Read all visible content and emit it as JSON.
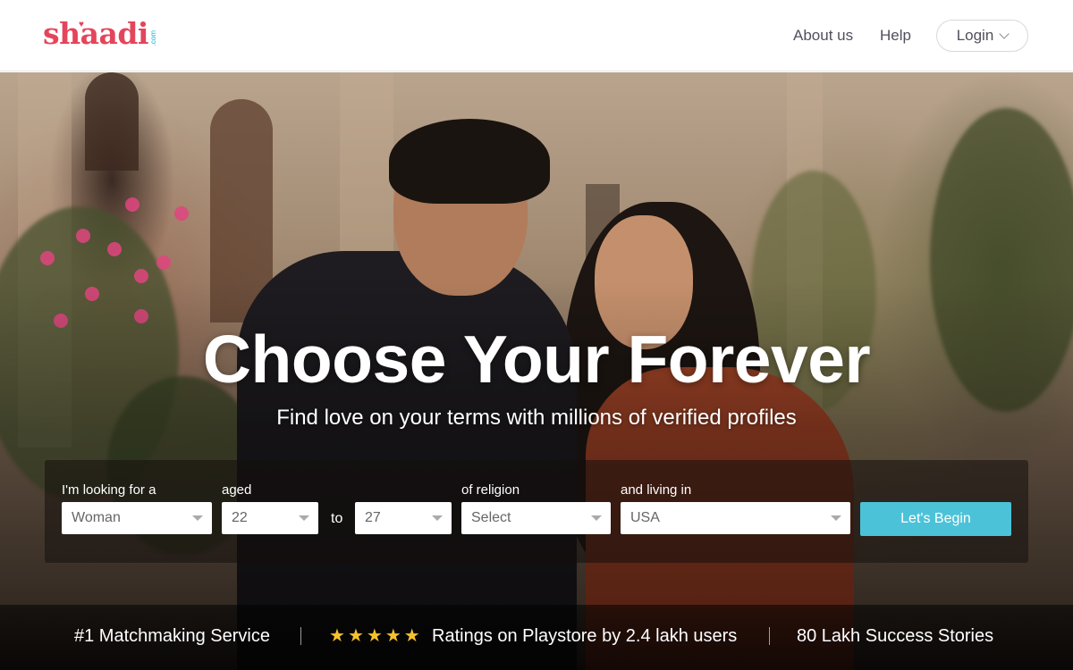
{
  "header": {
    "logo_text": "shaadi",
    "logo_suffix": ".com",
    "nav": {
      "about_label": "About us",
      "help_label": "Help"
    },
    "login_label": "Login"
  },
  "hero": {
    "title": "Choose Your Forever",
    "subtitle": "Find love on your terms with millions of verified profiles"
  },
  "search": {
    "looking_for": {
      "label": "I'm looking for a",
      "value": "Woman"
    },
    "aged": {
      "label": "aged",
      "from_value": "22",
      "to_label": "to",
      "to_value": "27"
    },
    "religion": {
      "label": "of religion",
      "value": "Select"
    },
    "living_in": {
      "label": "and living in",
      "value": "USA"
    },
    "submit_label": "Let's Begin"
  },
  "stats": {
    "item1": "#1 Matchmaking Service",
    "rating_stars": 5,
    "item2": "Ratings on Playstore by 2.4 lakh users",
    "item3": "80 Lakh Success Stories"
  },
  "colors": {
    "brand": "#e4455b",
    "accent_button": "#4cc2d8",
    "star": "#f6c22c"
  }
}
